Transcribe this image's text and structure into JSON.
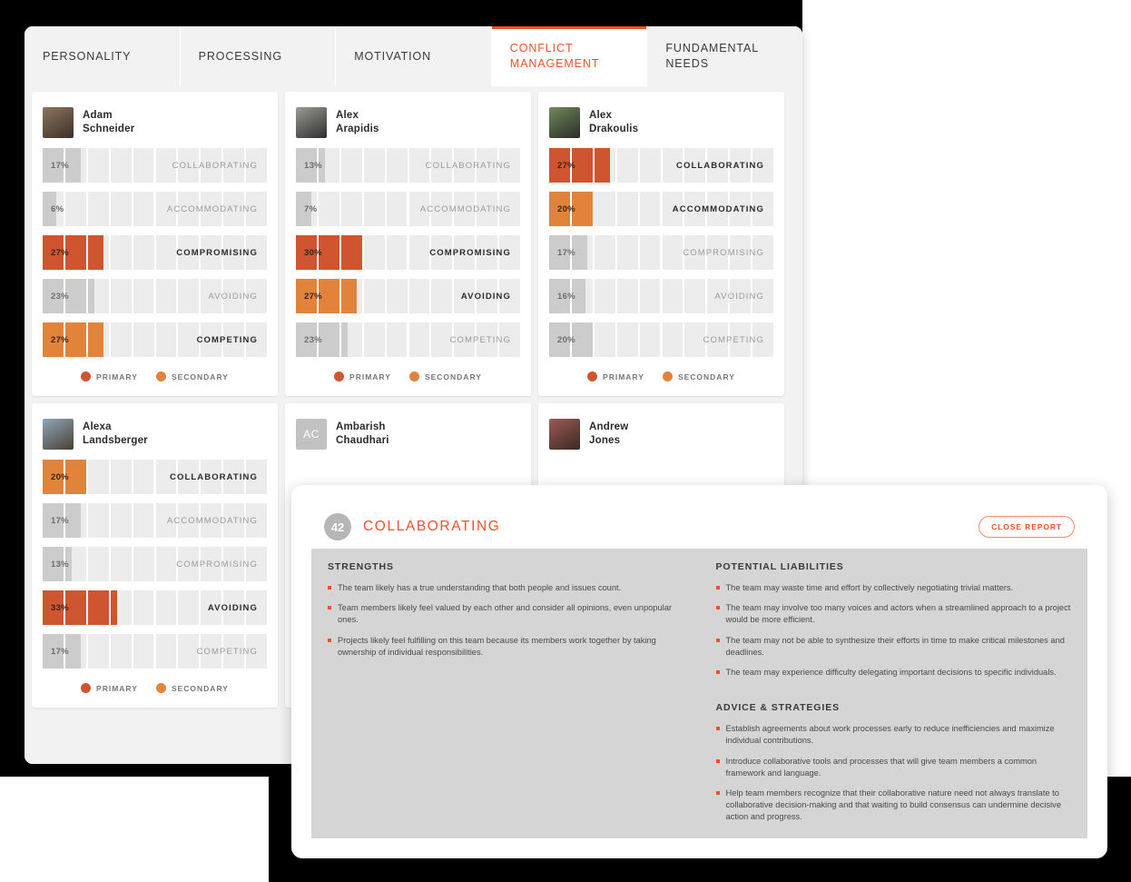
{
  "colors": {
    "primary": "#cf5430",
    "secondary": "#e1833a",
    "neutral": "#cccccc",
    "accent": "#f0512b",
    "track": "#ececec",
    "report_bg": "#d5d5d5"
  },
  "tabs": [
    {
      "label": "PERSONALITY",
      "active": false
    },
    {
      "label": "PROCESSING",
      "active": false
    },
    {
      "label": "MOTIVATION",
      "active": false
    },
    {
      "label": "CONFLICT MANAGEMENT",
      "active": true
    },
    {
      "label": "FUNDAMENTAL NEEDS",
      "active": false
    }
  ],
  "legend": {
    "primary_label": "PRIMARY",
    "secondary_label": "SECONDARY"
  },
  "cards": [
    {
      "first_name": "Adam",
      "last_name": "Schneider",
      "avatar_type": "photo",
      "avatar_initials": "",
      "avatar_color1": "#8a7560",
      "avatar_color2": "#3d3128",
      "rows": [
        {
          "label": "COLLABORATING",
          "pct": "17%",
          "value": 17,
          "state": "none"
        },
        {
          "label": "ACCOMMODATING",
          "pct": "6%",
          "value": 6,
          "state": "none"
        },
        {
          "label": "COMPROMISING",
          "pct": "27%",
          "value": 27,
          "state": "primary"
        },
        {
          "label": "AVOIDING",
          "pct": "23%",
          "value": 23,
          "state": "none"
        },
        {
          "label": "COMPETING",
          "pct": "27%",
          "value": 27,
          "state": "secondary"
        }
      ]
    },
    {
      "first_name": "Alex",
      "last_name": "Arapidis",
      "avatar_type": "photo",
      "avatar_initials": "",
      "avatar_color1": "#9a9a96",
      "avatar_color2": "#2e2e2c",
      "rows": [
        {
          "label": "COLLABORATING",
          "pct": "13%",
          "value": 13,
          "state": "none"
        },
        {
          "label": "ACCOMMODATING",
          "pct": "7%",
          "value": 7,
          "state": "none"
        },
        {
          "label": "COMPROMISING",
          "pct": "30%",
          "value": 30,
          "state": "primary"
        },
        {
          "label": "AVOIDING",
          "pct": "27%",
          "value": 27,
          "state": "secondary"
        },
        {
          "label": "COMPETING",
          "pct": "23%",
          "value": 23,
          "state": "none"
        }
      ]
    },
    {
      "first_name": "Alex",
      "last_name": "Drakoulis",
      "avatar_type": "photo",
      "avatar_initials": "",
      "avatar_color1": "#6f8a5a",
      "avatar_color2": "#2c2b29",
      "rows": [
        {
          "label": "COLLABORATING",
          "pct": "27%",
          "value": 27,
          "state": "primary"
        },
        {
          "label": "ACCOMMODATING",
          "pct": "20%",
          "value": 20,
          "state": "secondary"
        },
        {
          "label": "COMPROMISING",
          "pct": "17%",
          "value": 17,
          "state": "none"
        },
        {
          "label": "AVOIDING",
          "pct": "16%",
          "value": 16,
          "state": "none"
        },
        {
          "label": "COMPETING",
          "pct": "20%",
          "value": 20,
          "state": "none"
        }
      ]
    },
    {
      "first_name": "Alexa",
      "last_name": "Landsberger",
      "avatar_type": "photo",
      "avatar_initials": "",
      "avatar_color1": "#8fa6b8",
      "avatar_color2": "#4a4035",
      "rows": [
        {
          "label": "COLLABORATING",
          "pct": "20%",
          "value": 20,
          "state": "secondary"
        },
        {
          "label": "ACCOMMODATING",
          "pct": "17%",
          "value": 17,
          "state": "none"
        },
        {
          "label": "COMPROMISING",
          "pct": "13%",
          "value": 13,
          "state": "none"
        },
        {
          "label": "AVOIDING",
          "pct": "33%",
          "value": 33,
          "state": "primary"
        },
        {
          "label": "COMPETING",
          "pct": "17%",
          "value": 17,
          "state": "none"
        }
      ]
    },
    {
      "first_name": "Ambarish",
      "last_name": "Chaudhari",
      "avatar_type": "initials",
      "avatar_initials": "AC",
      "avatar_color1": "#c2c2c2",
      "avatar_color2": "#c2c2c2",
      "rows": []
    },
    {
      "first_name": "Andrew",
      "last_name": "Jones",
      "avatar_type": "photo",
      "avatar_initials": "",
      "avatar_color1": "#9c5a52",
      "avatar_color2": "#3a2a25",
      "rows": []
    }
  ],
  "report": {
    "score": "42",
    "title": "COLLABORATING",
    "close_label": "CLOSE REPORT",
    "strengths_heading": "STRENGTHS",
    "strengths": [
      "The team likely has a true understanding that both people and issues count.",
      "Team members likely feel valued by each other and consider all opinions, even unpopular ones.",
      "Projects likely feel fulfilling on this team because its members work together by taking ownership of individual responsibilities."
    ],
    "liabilities_heading": "POTENTIAL LIABILITIES",
    "liabilities": [
      "The team may waste time and effort by collectively negotiating trivial matters.",
      "The team may involve too many voices and actors when a streamlined approach to a project would be more efficient.",
      "The team may not be able to synthesize their efforts in time to make critical milestones and deadlines.",
      "The team may experience difficulty delegating important decisions to specific individuals."
    ],
    "advice_heading": "ADVICE & STRATEGIES",
    "advice": [
      "Establish agreements about work processes early to reduce inefficiencies and maximize individual contributions.",
      "Introduce collaborative tools and processes that will give team members a common framework and language.",
      "Help team members recognize that their collaborative nature need not always translate to collaborative decision-making and that waiting to build consensus can undermine decisive action and progress."
    ]
  }
}
